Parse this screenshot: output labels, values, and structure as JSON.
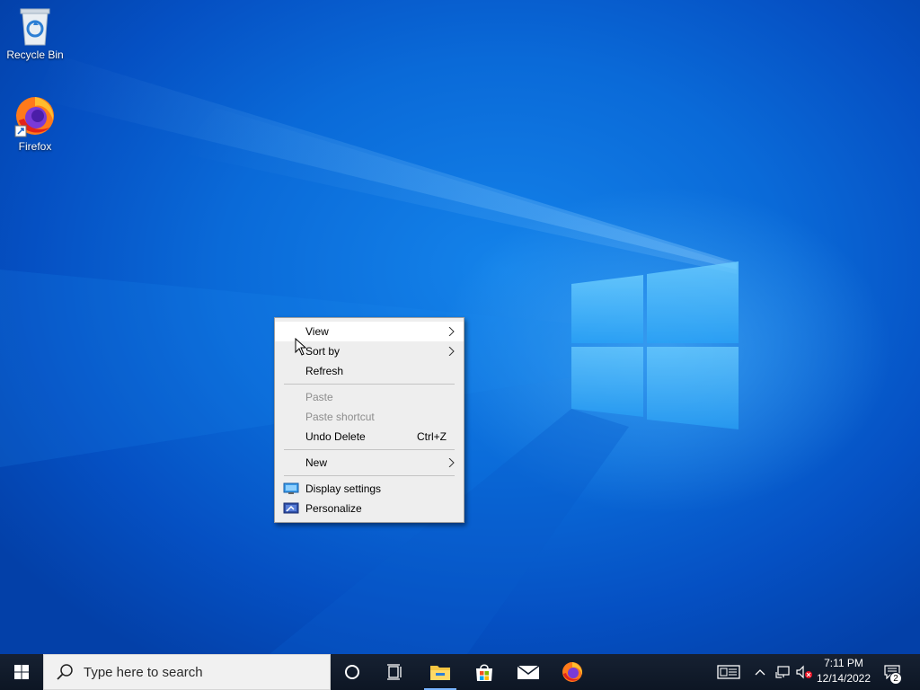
{
  "desktop": {
    "icons": [
      {
        "label": "Recycle Bin",
        "icon": "recycle-bin-icon"
      },
      {
        "label": "Firefox",
        "icon": "firefox-icon"
      }
    ]
  },
  "context_menu": {
    "items": {
      "view": {
        "label": "View",
        "has_submenu": true
      },
      "sort_by": {
        "label": "Sort by",
        "has_submenu": true
      },
      "refresh": {
        "label": "Refresh"
      },
      "paste": {
        "label": "Paste",
        "disabled": true
      },
      "paste_shortcut": {
        "label": "Paste shortcut",
        "disabled": true
      },
      "undo_delete": {
        "label": "Undo Delete",
        "shortcut": "Ctrl+Z"
      },
      "new": {
        "label": "New",
        "has_submenu": true
      },
      "display_settings": {
        "label": "Display settings",
        "icon": "display-settings-icon"
      },
      "personalize": {
        "label": "Personalize",
        "icon": "personalize-icon"
      }
    }
  },
  "taskbar": {
    "search_placeholder": "Type here to search",
    "pinned": [
      "start-icon",
      "cortana-icon",
      "task-view-icon",
      "file-explorer-icon",
      "microsoft-store-icon",
      "mail-icon",
      "firefox-icon"
    ],
    "clock": {
      "time": "7:11 PM",
      "date": "12/14/2022"
    },
    "notification_count": "2"
  },
  "colors": {
    "taskbar": "#101a2a",
    "menu_bg": "#eeeeee",
    "accent": "#0a6ad8"
  }
}
